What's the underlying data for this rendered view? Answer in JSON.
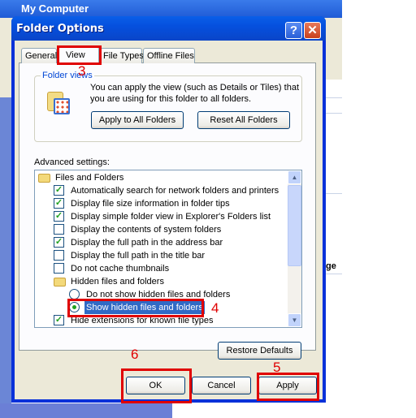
{
  "background_window": {
    "title": "My Computer",
    "partial_text": "ge"
  },
  "dialog": {
    "title": "Folder Options",
    "help_label": "?",
    "close_label": "✕",
    "tabs": [
      {
        "label": "General"
      },
      {
        "label": "View",
        "active": true
      },
      {
        "label": "File Types"
      },
      {
        "label": "Offline Files"
      }
    ],
    "folder_views": {
      "legend": "Folder views",
      "description_line1": "You can apply the view (such as Details or Tiles) that",
      "description_line2": "you are using for this folder to all folders.",
      "apply_all_label": "Apply to All Folders",
      "reset_all_label": "Reset All Folders"
    },
    "advanced_label": "Advanced settings:",
    "advanced_items": [
      {
        "type": "folder",
        "label": "Files and Folders",
        "indent": 0
      },
      {
        "type": "checkbox",
        "label": "Automatically search for network folders and printers",
        "checked": true,
        "indent": 1
      },
      {
        "type": "checkbox",
        "label": "Display file size information in folder tips",
        "checked": true,
        "indent": 1
      },
      {
        "type": "checkbox",
        "label": "Display simple folder view in Explorer's Folders list",
        "checked": true,
        "indent": 1
      },
      {
        "type": "checkbox",
        "label": "Display the contents of system folders",
        "checked": false,
        "indent": 1
      },
      {
        "type": "checkbox",
        "label": "Display the full path in the address bar",
        "checked": true,
        "indent": 1
      },
      {
        "type": "checkbox",
        "label": "Display the full path in the title bar",
        "checked": false,
        "indent": 1
      },
      {
        "type": "checkbox",
        "label": "Do not cache thumbnails",
        "checked": false,
        "indent": 1
      },
      {
        "type": "folder",
        "label": "Hidden files and folders",
        "indent": 1
      },
      {
        "type": "radio",
        "label": "Do not show hidden files and folders",
        "checked": false,
        "indent": 2
      },
      {
        "type": "radio",
        "label": "Show hidden files and folders",
        "checked": true,
        "selected": true,
        "indent": 2
      },
      {
        "type": "checkbox",
        "label": "Hide extensions for known file types",
        "checked": true,
        "indent": 1
      }
    ],
    "restore_defaults_label": "Restore Defaults",
    "ok_label": "OK",
    "cancel_label": "Cancel",
    "apply_label": "Apply"
  },
  "annotations": {
    "step3": "3",
    "step4": "4",
    "step5": "5",
    "step6": "6",
    "color": "#e00000"
  }
}
